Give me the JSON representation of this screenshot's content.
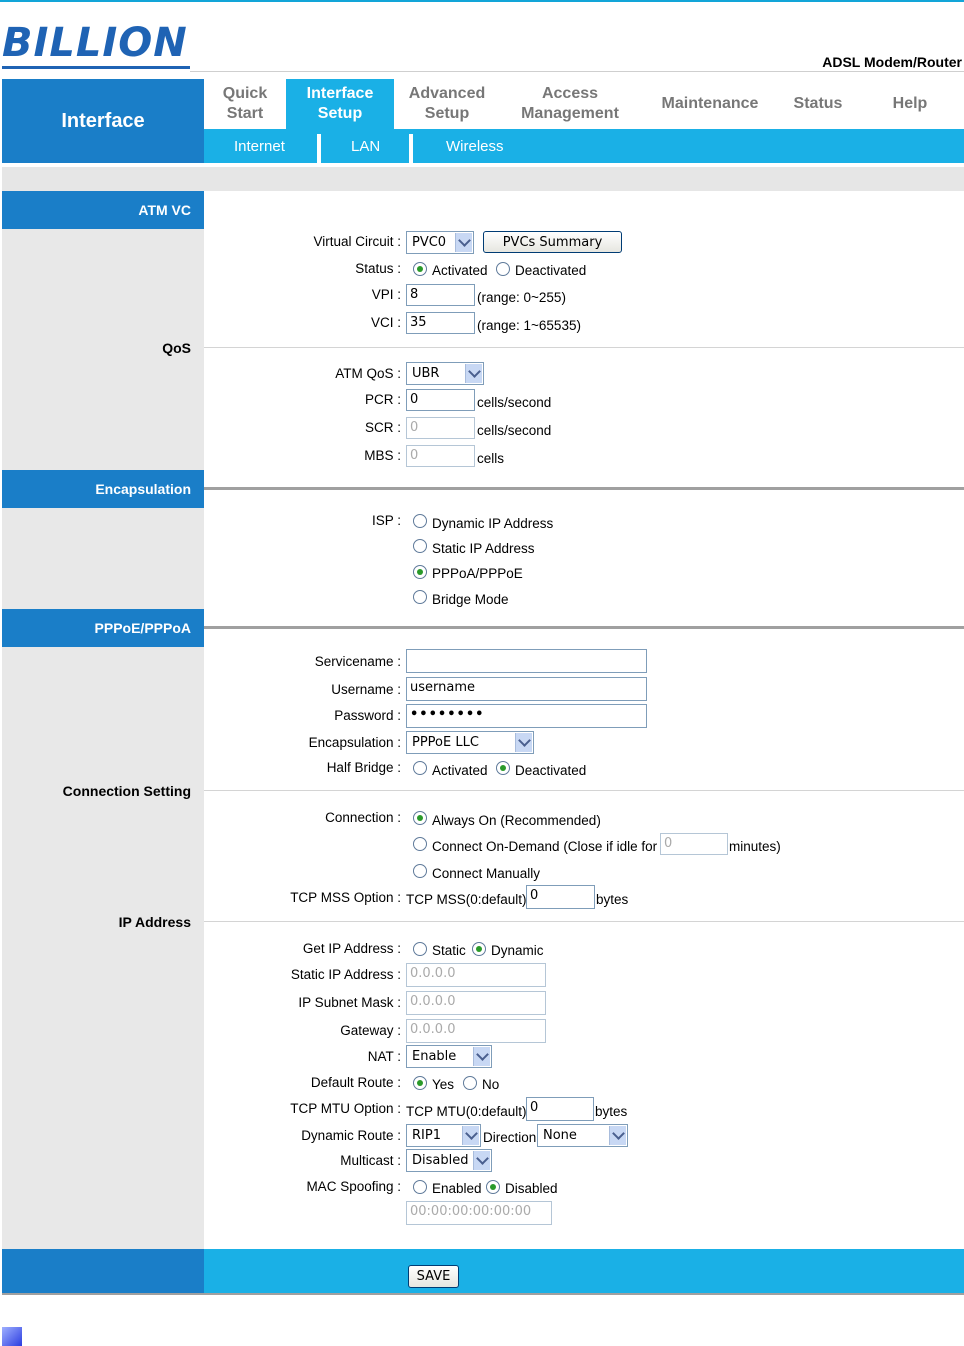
{
  "header": {
    "logo": "BILLION",
    "product": "ADSL Modem/Router"
  },
  "nav": {
    "section": "Interface",
    "tabs": [
      {
        "label": "Quick Start"
      },
      {
        "label": "Interface Setup"
      },
      {
        "label": "Advanced Setup"
      },
      {
        "label": "Access Management"
      },
      {
        "label": "Maintenance"
      },
      {
        "label": "Status"
      },
      {
        "label": "Help"
      }
    ],
    "subtabs": [
      "Internet",
      "LAN",
      "Wireless"
    ]
  },
  "sections": {
    "atm_vc": "ATM VC",
    "qos": "QoS",
    "encapsulation": "Encapsulation",
    "pppoe": "PPPoE/PPPoA",
    "connection_setting": "Connection Setting",
    "ip_address": "IP Address"
  },
  "atm": {
    "virtual_circuit_label": "Virtual Circuit",
    "virtual_circuit_value": "PVC0",
    "pvcs_summary_button": "PVCs Summary",
    "status_label": "Status",
    "status_options": [
      "Activated",
      "Deactivated"
    ],
    "vpi_label": "VPI",
    "vpi_value": "8",
    "vpi_range": "(range: 0~255)",
    "vci_label": "VCI",
    "vci_value": "35",
    "vci_range": "(range: 1~65535)"
  },
  "qos": {
    "atm_qos_label": "ATM QoS",
    "atm_qos_value": "UBR",
    "pcr_label": "PCR",
    "pcr_value": "0",
    "pcr_unit": "cells/second",
    "scr_label": "SCR",
    "scr_value": "0",
    "scr_unit": "cells/second",
    "mbs_label": "MBS",
    "mbs_value": "0",
    "mbs_unit": "cells"
  },
  "encap": {
    "isp_label": "ISP",
    "options": [
      "Dynamic IP Address",
      "Static IP Address",
      "PPPoA/PPPoE",
      "Bridge Mode"
    ]
  },
  "pppoe": {
    "servicename_label": "Servicename",
    "servicename_value": "",
    "username_label": "Username",
    "username_value": "username",
    "password_label": "Password",
    "password_value": "••••••••",
    "encapsulation_label": "Encapsulation",
    "encapsulation_value": "PPPoE LLC",
    "half_bridge_label": "Half Bridge",
    "half_bridge_options": [
      "Activated",
      "Deactivated"
    ]
  },
  "connection": {
    "connection_label": "Connection",
    "always_on": "Always On (Recommended)",
    "on_demand": "Connect On-Demand (Close if idle for",
    "idle_value": "0",
    "minutes": "minutes)",
    "manually": "Connect Manually",
    "tcp_mss_label": "TCP MSS Option",
    "tcp_mss_text": "TCP MSS(0:default)",
    "tcp_mss_value": "0",
    "tcp_mss_unit": "bytes"
  },
  "ip": {
    "get_ip_label": "Get IP Address",
    "get_ip_options": [
      "Static",
      "Dynamic"
    ],
    "static_ip_label": "Static IP Address",
    "static_ip_value": "0.0.0.0",
    "subnet_label": "IP Subnet Mask",
    "subnet_value": "0.0.0.0",
    "gateway_label": "Gateway",
    "gateway_value": "0.0.0.0",
    "nat_label": "NAT",
    "nat_value": "Enable",
    "default_route_label": "Default Route",
    "default_route_options": [
      "Yes",
      "No"
    ],
    "tcp_mtu_label": "TCP MTU Option",
    "tcp_mtu_text": "TCP MTU(0:default)",
    "tcp_mtu_value": "0",
    "tcp_mtu_unit": "bytes",
    "dynamic_route_label": "Dynamic Route",
    "dynamic_route_value": "RIP1",
    "direction_label": "Direction",
    "direction_value": "None",
    "multicast_label": "Multicast",
    "multicast_value": "Disabled",
    "mac_spoofing_label": "MAC Spoofing",
    "mac_spoofing_options": [
      "Enabled",
      "Disabled"
    ],
    "mac_value": "00:00:00:00:00:00"
  },
  "save_button": "SAVE",
  "colors": {
    "primary_blue": "#1a7ec8",
    "light_blue": "#1ab0e6",
    "logo_blue": "#1f63b4"
  }
}
